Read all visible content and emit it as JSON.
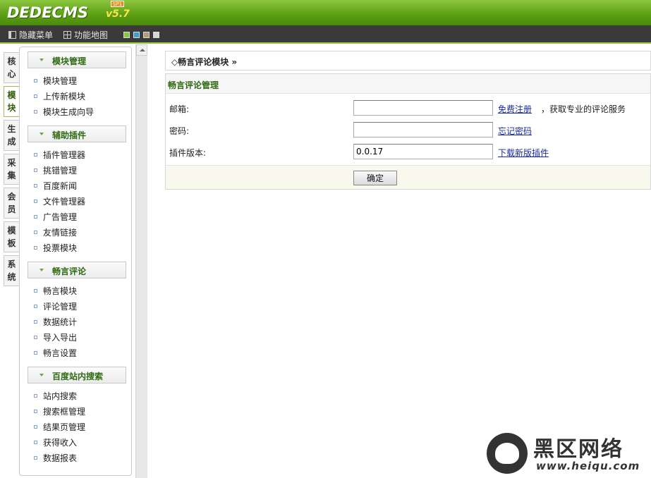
{
  "header": {
    "logo": "DEDECMS",
    "version": "v5.7",
    "sp_badge": "SP1"
  },
  "toolbar": {
    "hide_menu": "隐藏菜单",
    "site_map": "功能地图",
    "theme_swatches": [
      "#8fc43d",
      "#3aa0d0",
      "#b49a78",
      "#d8d8d8"
    ]
  },
  "side_tabs": [
    {
      "line1": "核",
      "line2": "心"
    },
    {
      "line1": "模",
      "line2": "块"
    },
    {
      "line1": "生",
      "line2": "成"
    },
    {
      "line1": "采",
      "line2": "集"
    },
    {
      "line1": "会",
      "line2": "员"
    },
    {
      "line1": "模",
      "line2": "板"
    },
    {
      "line1": "系",
      "line2": "统"
    }
  ],
  "menu": {
    "groups": [
      {
        "title": "模块管理",
        "items": [
          "模块管理",
          "上传新模块",
          "模块生成向导"
        ]
      },
      {
        "title": "辅助插件",
        "items": [
          "插件管理器",
          "挑错管理",
          "百度新闻",
          "文件管理器",
          "广告管理",
          "友情链接",
          "投票模块"
        ]
      },
      {
        "title": "畅言评论",
        "items": [
          "畅言模块",
          "评论管理",
          "数据统计",
          "导入导出",
          "畅言设置"
        ]
      },
      {
        "title": "百度站内搜索",
        "items": [
          "站内搜索",
          "搜索框管理",
          "结果页管理",
          "获得收入",
          "数据报表"
        ]
      }
    ]
  },
  "main": {
    "breadcrumb": "◇畅言评论模块 »",
    "panel_title": "畅言评论管理",
    "email_label": "邮箱:",
    "email_value": "",
    "register_link": "免费注册",
    "register_note": "，获取专业的评论服务",
    "password_label": "密码:",
    "password_value": "",
    "forgot_link": "忘记密码",
    "version_label": "插件版本:",
    "version_value": "0.0.17",
    "download_link": "下载新版插件",
    "ok_button": "确定"
  },
  "watermark": {
    "title": "黑区网络",
    "url": "www.heiqu.com"
  }
}
